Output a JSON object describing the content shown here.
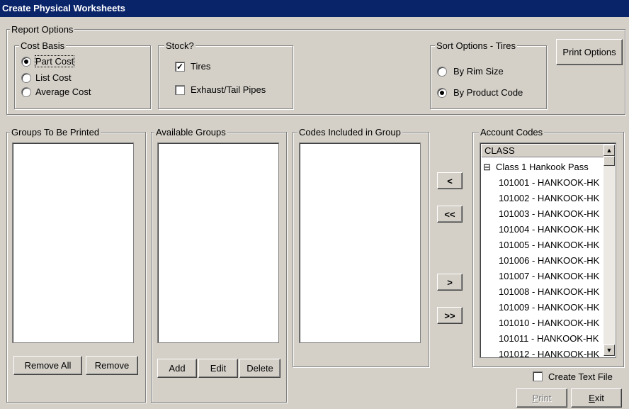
{
  "window": {
    "title": "Create Physical Worksheets"
  },
  "report_options": {
    "legend": "Report Options",
    "cost_basis": {
      "legend": "Cost Basis",
      "options": [
        {
          "label": "Part Cost",
          "selected": true
        },
        {
          "label": "List Cost",
          "selected": false
        },
        {
          "label": "Average Cost",
          "selected": false
        }
      ]
    },
    "stock": {
      "legend": "Stock?",
      "options": [
        {
          "label": "Tires",
          "checked": true
        },
        {
          "label": "Exhaust/Tail Pipes",
          "checked": false
        }
      ]
    },
    "sort_options": {
      "legend": "Sort Options - Tires",
      "options": [
        {
          "label": "By Rim Size",
          "selected": false
        },
        {
          "label": "By Product Code",
          "selected": true
        }
      ]
    },
    "print_options_label": "Print Options"
  },
  "groups_to_print": {
    "legend": "Groups To Be Printed",
    "remove_all_label": "Remove All",
    "remove_label": "Remove"
  },
  "available_groups": {
    "legend": "Available Groups",
    "add_label": "Add",
    "edit_label": "Edit",
    "delete_label": "Delete"
  },
  "codes_in_group": {
    "legend": "Codes Included in Group"
  },
  "transfer_buttons": {
    "move_left": "<",
    "move_all_left": "<<",
    "move_right": ">",
    "move_all_right": ">>"
  },
  "account_codes": {
    "legend": "Account Codes",
    "header": "CLASS",
    "expand_glyph": "⊟",
    "group_label": "Class 1 Hankook Pass",
    "items": [
      "101001 - HANKOOK-HK",
      "101002 - HANKOOK-HK",
      "101003 - HANKOOK-HK",
      "101004 - HANKOOK-HK",
      "101005 - HANKOOK-HK",
      "101006 - HANKOOK-HK",
      "101007 - HANKOOK-HK",
      "101008 - HANKOOK-HK",
      "101009 - HANKOOK-HK",
      "101010 - HANKOOK-HK",
      "101011 - HANKOOK-HK",
      "101012 - HANKOOK-HK"
    ]
  },
  "footer": {
    "create_text_file_label": "Create Text File",
    "create_text_file_checked": false,
    "print_label_prefix": "",
    "print_mnemonic": "P",
    "print_label_rest": "rint",
    "exit_mnemonic": "E",
    "exit_label_rest": "xit"
  },
  "colors": {
    "title_bar": "#0a246a",
    "face": "#d4d0c8"
  }
}
